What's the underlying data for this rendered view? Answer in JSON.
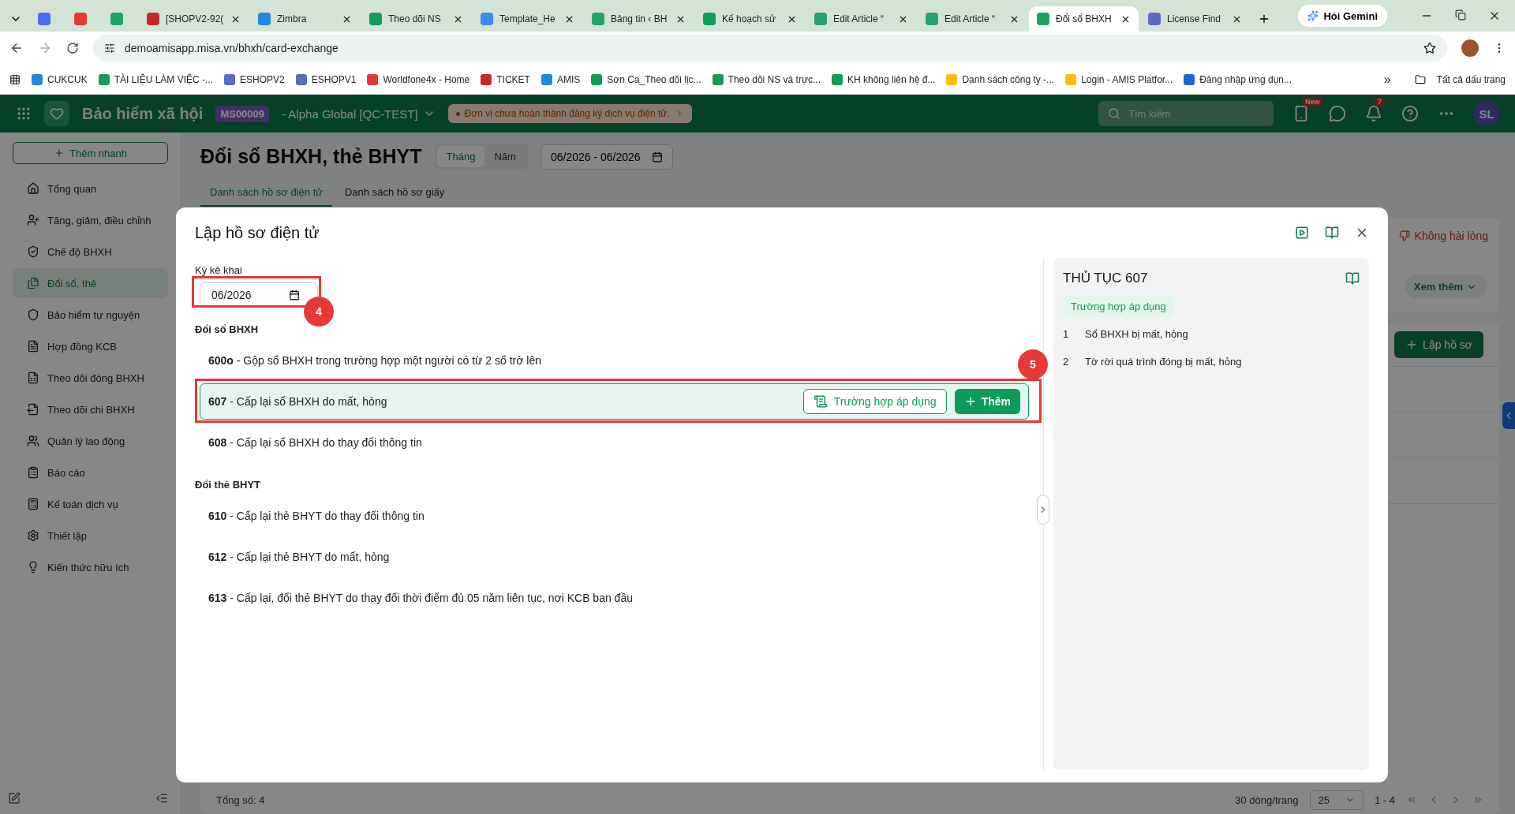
{
  "browser": {
    "tabs": [
      {
        "color": "#4f6bed",
        "selected": false
      },
      {
        "color": "#e53935",
        "selected": false
      },
      {
        "color": "#1fa463",
        "selected": false
      },
      {
        "title": "[SHOPV2-92(",
        "color": "#c62828",
        "selected": false
      },
      {
        "title": "Zimbra",
        "color": "#1e88e5",
        "selected": false
      },
      {
        "title": "Theo dõi NS",
        "color": "#0f9d58",
        "selected": false
      },
      {
        "title": "Template_He",
        "color": "#4285f4",
        "selected": false
      },
      {
        "title": "Bảng tin ‹ BH",
        "color": "#26a269",
        "selected": false
      },
      {
        "title": "Kế hoạch sử",
        "color": "#0f9d58",
        "selected": false
      },
      {
        "title": "Edit Article “",
        "color": "#26a269",
        "selected": false
      },
      {
        "title": "Edit Article “",
        "color": "#26a269",
        "selected": false
      },
      {
        "title": "Đổi sổ BHXH",
        "color": "#1aa260",
        "selected": true
      },
      {
        "title": "License Find",
        "color": "#5c6bc0",
        "selected": false
      }
    ],
    "gemini": "Hỏi Gemini",
    "url": "demoamisapp.misa.vn/bhxh/card-exchange",
    "bookmarks": [
      {
        "label": "CUKCUK",
        "color": "#1e88e5"
      },
      {
        "label": "TÀI LIỆU LÀM VIỆC -...",
        "color": "#0f9d58"
      },
      {
        "label": "ESHOPV2",
        "color": "#5c6bc0"
      },
      {
        "label": "ESHOPV1",
        "color": "#5c6bc0"
      },
      {
        "label": "Worldfone4x - Home",
        "color": "#e53935"
      },
      {
        "label": "TICKET",
        "color": "#c62828"
      },
      {
        "label": "AMIS",
        "color": "#1e88e5"
      },
      {
        "label": "Sơn Ca_Theo dõi lịc...",
        "color": "#0f9d58"
      },
      {
        "label": "Theo dõi NS và trực...",
        "color": "#0f9d58"
      },
      {
        "label": "KH không liên hệ đ...",
        "color": "#0f9d58"
      },
      {
        "label": "Danh sách công ty -...",
        "color": "#fbbc04"
      },
      {
        "label": "Login - AMIS Platfor...",
        "color": "#fbbc04"
      },
      {
        "label": "Đăng nhập ứng dụn...",
        "color": "#1e63d6"
      }
    ],
    "more": "»",
    "all_bookmarks": "Tất cả dấu trang"
  },
  "app": {
    "title": "Bảo hiểm xã hội",
    "company_code": "MS00009",
    "company": "- Alpha Global [QC-TEST]",
    "notice": "Đơn vị chưa hoàn thành đăng ký dịch vụ điện tử.",
    "search_placeholder": "Tìm kiếm",
    "new_badge": "New",
    "notification_count": "7",
    "avatar": "SL"
  },
  "sidebar": {
    "quick_add": "Thêm nhanh",
    "items": [
      {
        "label": "Tổng quan",
        "selected": false
      },
      {
        "label": "Tăng, giảm, điều chỉnh",
        "selected": false
      },
      {
        "label": "Chế độ BHXH",
        "selected": false
      },
      {
        "label": "Đổi sổ, thẻ",
        "selected": true
      },
      {
        "label": "Bảo hiểm tự nguyện",
        "selected": false
      },
      {
        "label": "Hợp đồng KCB",
        "selected": false
      },
      {
        "label": "Theo dõi đóng BHXH",
        "selected": false
      },
      {
        "label": "Theo dõi chi BHXH",
        "selected": false
      },
      {
        "label": "Quản lý lao động",
        "selected": false
      },
      {
        "label": "Báo cáo",
        "selected": false
      },
      {
        "label": "Kế toán dịch vụ",
        "selected": false
      },
      {
        "label": "Thiết lập",
        "selected": false
      },
      {
        "label": "Kiến thức hữu ích",
        "selected": false
      }
    ]
  },
  "page": {
    "title": "Đổi sổ BHXH, thẻ BHYT",
    "period_toggle": [
      {
        "label": "Tháng",
        "selected": true
      },
      {
        "label": "Năm",
        "selected": false
      }
    ],
    "range": "06/2026 - 06/2026",
    "tabs": [
      {
        "label": "Danh sách hồ sơ điện tử",
        "selected": true
      },
      {
        "label": "Danh sách hồ sơ giấy",
        "selected": false
      }
    ],
    "feedback": "Không hài lòng",
    "see_more": "Xem thêm",
    "create": "Lập hồ sơ",
    "footer": {
      "total": "Tổng số: 4",
      "per_page": "30 dòng/trang",
      "page_size": "25",
      "range": "1 - 4"
    }
  },
  "modal": {
    "title": "Lập hồ sơ điện tử",
    "period_label": "Kỳ kê khai",
    "period_value": "06/2026",
    "period_step": "4",
    "groups": [
      {
        "title": "Đổi sổ BHXH",
        "items": [
          {
            "code": "600o",
            "text": "- Gộp sổ BHXH trong trường hợp một người có từ 2 sổ trở lên",
            "selected": false
          },
          {
            "code": "607",
            "text": "- Cấp lại sổ BHXH do mất, hỏng",
            "selected": true,
            "step": "5"
          },
          {
            "code": "608",
            "text": "- Cấp lại sổ BHXH do thay đổi thông tin",
            "selected": false
          }
        ]
      },
      {
        "title": "Đổi thẻ BHYT",
        "items": [
          {
            "code": "610",
            "text": "- Cấp lại thẻ BHYT do thay đổi thông tin",
            "selected": false
          },
          {
            "code": "612",
            "text": "- Cấp lại thẻ BHYT do mất, hỏng",
            "selected": false
          },
          {
            "code": "613",
            "text": "- Cấp lại, đổi thẻ BHYT do thay đổi thời điểm đủ 05 năm liên tục, nơi KCB ban đầu",
            "selected": false
          }
        ]
      }
    ],
    "apply_button": "Trường hợp áp dụng",
    "add_button": "Thêm",
    "detail": {
      "title": "THỦ TỤC 607",
      "tag": "Trường hợp áp dụng",
      "cases": [
        {
          "no": "1",
          "text": "Sổ BHXH bị mất, hỏng"
        },
        {
          "no": "2",
          "text": "Tờ rời quá trình đóng bị mất, hỏng"
        }
      ]
    }
  }
}
